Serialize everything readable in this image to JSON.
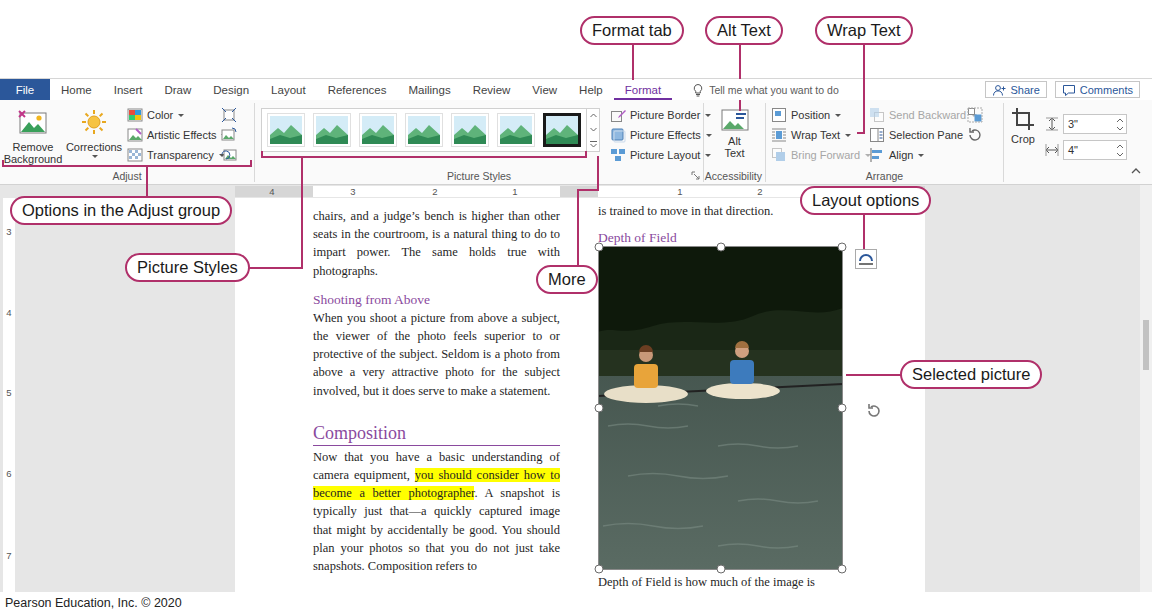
{
  "callouts": [
    {
      "label": "Format tab"
    },
    {
      "label": "Alt Text"
    },
    {
      "label": "Wrap Text"
    },
    {
      "label": "Options in the Adjust group"
    },
    {
      "label": "Picture Styles"
    },
    {
      "label": "More"
    },
    {
      "label": "Layout options"
    },
    {
      "label": "Selected picture"
    }
  ],
  "ribbon": {
    "file_tab": "File",
    "tabs": [
      {
        "label": "Home",
        "selected": false
      },
      {
        "label": "Insert",
        "selected": false
      },
      {
        "label": "Draw",
        "selected": false
      },
      {
        "label": "Design",
        "selected": false
      },
      {
        "label": "Layout",
        "selected": false
      },
      {
        "label": "References",
        "selected": false
      },
      {
        "label": "Mailings",
        "selected": false
      },
      {
        "label": "Review",
        "selected": false
      },
      {
        "label": "View",
        "selected": false
      },
      {
        "label": "Help",
        "selected": false
      },
      {
        "label": "Format",
        "selected": true
      }
    ],
    "search": {
      "placeholder": "Tell me what you want to do"
    },
    "share": "Share",
    "comments": "Comments",
    "adjust": {
      "label": "Adjust",
      "large": [
        {
          "label": "Remove Background",
          "menu": false
        },
        {
          "label": "Corrections",
          "menu": true
        }
      ],
      "small": [
        {
          "label": "Color",
          "menu": true
        },
        {
          "label": "Artistic Effects",
          "menu": true
        },
        {
          "label": "Transparency",
          "menu": true
        }
      ]
    },
    "picture_styles": {
      "label": "Picture Styles",
      "styles": [
        {
          "selected": false
        },
        {
          "selected": false
        },
        {
          "selected": false
        },
        {
          "selected": false
        },
        {
          "selected": false
        },
        {
          "selected": false
        },
        {
          "selected": true
        }
      ],
      "commands": [
        {
          "label": "Picture Border",
          "menu": true
        },
        {
          "label": "Picture Effects",
          "menu": true
        },
        {
          "label": "Picture Layout",
          "menu": true
        }
      ]
    },
    "accessibility": {
      "label": "Accessibility",
      "alt_text": "Alt Text"
    },
    "arrange": {
      "label": "Arrange",
      "commands": [
        {
          "label": "Position",
          "menu": true,
          "disabled": false
        },
        {
          "label": "Wrap Text",
          "menu": true,
          "disabled": false
        },
        {
          "label": "Bring Forward",
          "menu": true,
          "disabled": true
        },
        {
          "label": "Send Backward",
          "menu": true,
          "disabled": true
        },
        {
          "label": "Selection Pane",
          "menu": false,
          "disabled": false
        },
        {
          "label": "Align",
          "menu": true,
          "disabled": false
        }
      ]
    },
    "size": {
      "crop": "Crop",
      "height": "3\"",
      "width": "4\""
    }
  },
  "rulers": {
    "horizontal": [
      "4",
      "3",
      "2",
      "1",
      "1",
      "2"
    ],
    "vertical": [
      "3",
      "4",
      "5",
      "6",
      "7"
    ]
  },
  "document": {
    "left_column": [
      {
        "kind": "paragraph",
        "text": "chairs, and a judge’s bench is higher than other seats in the courtroom, is a natural thing to do to impart power. The same holds true with photographs."
      },
      {
        "kind": "heading",
        "text": "Shooting from Above"
      },
      {
        "kind": "paragraph",
        "text": "When you shoot a picture from above a subject, the viewer of the photo feels superior to or protective of the subject. Seldom is a photo from above a very attractive photo for the subject involved, but it does serve to make a statement."
      },
      {
        "kind": "title",
        "text": "Composition"
      },
      {
        "kind": "paragraph",
        "runs": [
          {
            "text": "Now that you have a basic understanding of camera equipment, ",
            "highlighted": false
          },
          {
            "text": "you should consider how to become a better photographer",
            "highlighted": true
          },
          {
            "text": ". A snapshot is typically just that—a quickly captured image that might by accidentally be good. You should plan your photos so that you do not just take snapshots. Composition refers to",
            "highlighted": false
          }
        ]
      }
    ],
    "right_column": [
      {
        "kind": "paragraph",
        "text": "is trained to move in that direction."
      },
      {
        "kind": "heading",
        "text": "Depth of Field"
      },
      {
        "kind": "picture",
        "selected": true
      },
      {
        "kind": "paragraph",
        "text": "Depth of Field is how much of the image is"
      }
    ]
  },
  "caption": "Pearson Education, Inc. © 2020"
}
